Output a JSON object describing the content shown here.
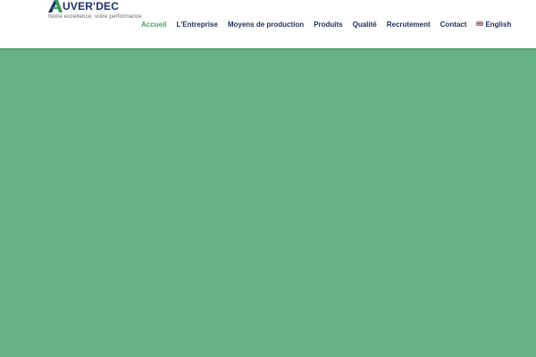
{
  "logo": {
    "text": "UVER'DEC",
    "mark_letter": "A",
    "tagline": "Notre excellence, votre performance",
    "icon": "logo-icon"
  },
  "nav": {
    "items": [
      {
        "label": "Accueil",
        "active": true
      },
      {
        "label": "L'Entreprise",
        "active": false
      },
      {
        "label": "Moyens de production",
        "active": false
      },
      {
        "label": "Produits",
        "active": false
      },
      {
        "label": "Qualité",
        "active": false
      },
      {
        "label": "Recrutement",
        "active": false
      },
      {
        "label": "Contact",
        "active": false
      }
    ],
    "language": {
      "label": "English",
      "icon": "uk-flag-icon"
    }
  },
  "colors": {
    "accent": "#4aa462",
    "nav_text": "#1e2e5b",
    "hero_bg": "#68b385",
    "logo_text": "#1b2f6e"
  }
}
